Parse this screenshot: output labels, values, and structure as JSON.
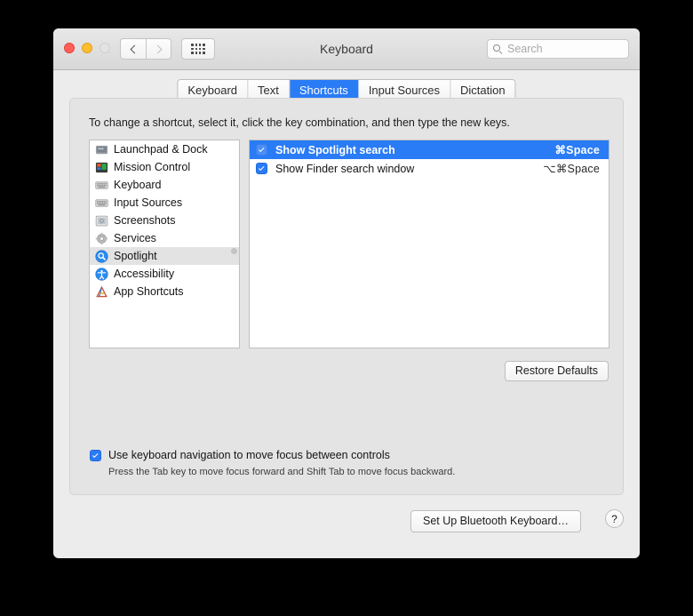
{
  "window": {
    "title": "Keyboard",
    "traffic": {
      "close": "close-button",
      "minimize": "minimize-button",
      "zoom": "zoom-button"
    },
    "nav": {
      "back": "back-button",
      "forward": "forward-button",
      "grid": "show-all-button"
    },
    "search": {
      "placeholder": "Search",
      "value": ""
    }
  },
  "tabs": [
    {
      "label": "Keyboard",
      "active": false
    },
    {
      "label": "Text",
      "active": false
    },
    {
      "label": "Shortcuts",
      "active": true
    },
    {
      "label": "Input Sources",
      "active": false
    },
    {
      "label": "Dictation",
      "active": false
    }
  ],
  "main": {
    "hint": "To change a shortcut, select it, click the key combination, and then type the new keys.",
    "categories": [
      {
        "label": "Launchpad & Dock",
        "icon": "launchpad-dock-icon",
        "selected": false
      },
      {
        "label": "Mission Control",
        "icon": "mission-control-icon",
        "selected": false
      },
      {
        "label": "Keyboard",
        "icon": "keyboard-icon",
        "selected": false
      },
      {
        "label": "Input Sources",
        "icon": "input-sources-icon",
        "selected": false
      },
      {
        "label": "Screenshots",
        "icon": "screenshots-icon",
        "selected": false
      },
      {
        "label": "Services",
        "icon": "services-gear-icon",
        "selected": false
      },
      {
        "label": "Spotlight",
        "icon": "spotlight-icon",
        "selected": true
      },
      {
        "label": "Accessibility",
        "icon": "accessibility-icon",
        "selected": false
      },
      {
        "label": "App Shortcuts",
        "icon": "app-shortcuts-icon",
        "selected": false
      }
    ],
    "shortcuts": [
      {
        "name": "Show Spotlight search",
        "keys": "⌘Space",
        "checked": true,
        "selected": true
      },
      {
        "name": "Show Finder search window",
        "keys": "⌥⌘Space",
        "checked": true,
        "selected": false
      }
    ],
    "restore_defaults_label": "Restore Defaults",
    "keyboard_nav": {
      "label": "Use keyboard navigation to move focus between controls",
      "checked": true,
      "sublabel": "Press the Tab key to move focus forward and Shift Tab to move focus backward."
    }
  },
  "footer": {
    "bluetooth_label": "Set Up Bluetooth Keyboard…",
    "help_label": "?"
  },
  "colors": {
    "accent": "#2a7bf6",
    "window_bg": "#ececec",
    "panel_bg": "#e4e4e4",
    "list_bg": "#ffffff"
  }
}
